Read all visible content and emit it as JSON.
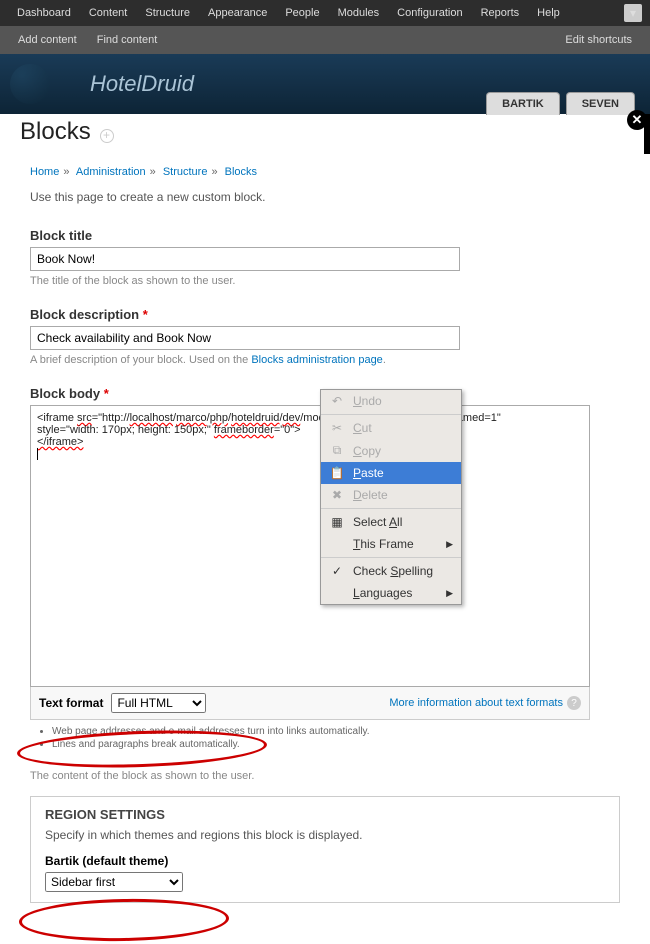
{
  "topbar": [
    "Dashboard",
    "Content",
    "Structure",
    "Appearance",
    "People",
    "Modules",
    "Configuration",
    "Reports",
    "Help"
  ],
  "subbar": {
    "add": "Add content",
    "find": "Find content",
    "edit": "Edit shortcuts"
  },
  "site_name": "HotelDruid",
  "page_title": "Blocks",
  "tabs": {
    "bartik": "BARTIK",
    "seven": "SEVEN"
  },
  "crumbs": {
    "home": "Home",
    "admin": "Administration",
    "structure": "Structure",
    "blocks": "Blocks"
  },
  "intro": "Use this page to create a new custom block.",
  "fields": {
    "title": {
      "label": "Block title",
      "value": "Book Now!",
      "help": "The title of the block as shown to the user."
    },
    "desc": {
      "label": "Block description",
      "value": "Check availability and Book Now",
      "help_pre": "A brief description of your block. Used on the ",
      "help_link": "Blocks administration page",
      "help_post": "."
    },
    "body": {
      "label": "Block body",
      "line1_a": "<iframe ",
      "line1_b": "src",
      "line1_c": "=\"http://",
      "line1_d": "localhost",
      "line1_e": "/",
      "line1_f": "marco",
      "line1_g": "/",
      "line1_h": "php",
      "line1_i": "/",
      "line1_j": "hoteldruid",
      "line1_k": "/",
      "line1_l": "dev",
      "line1_m": "/mod/instant_booking_tpl.php?framed=1\"",
      "line2_a": " style=\"width: 170px; height: 150px;\" ",
      "line2_b": "frameborder",
      "line2_c": "=\"0\">",
      "line3": "</iframe>"
    },
    "format": {
      "label": "Text format",
      "value": "Full HTML",
      "more": "More information about text formats"
    },
    "tips": [
      "Web page addresses and e-mail addresses turn into links automatically.",
      "Lines and paragraphs break automatically."
    ],
    "content_help": "The content of the block as shown to the user."
  },
  "region": {
    "legend": "REGION SETTINGS",
    "help": "Specify in which themes and regions this block is displayed.",
    "theme_label": "Bartik (default theme)",
    "value": "Sidebar first"
  },
  "contextmenu": {
    "undo": "ndo",
    "cut": "ut",
    "copy": "opy",
    "paste": "aste",
    "delete": "elete",
    "selectall_a": "Select ",
    "selectall_b": "ll",
    "thisframe_a": "his Frame",
    "checkspell_a": "Check ",
    "checkspell_b": "pelling",
    "languages": "anguages"
  }
}
